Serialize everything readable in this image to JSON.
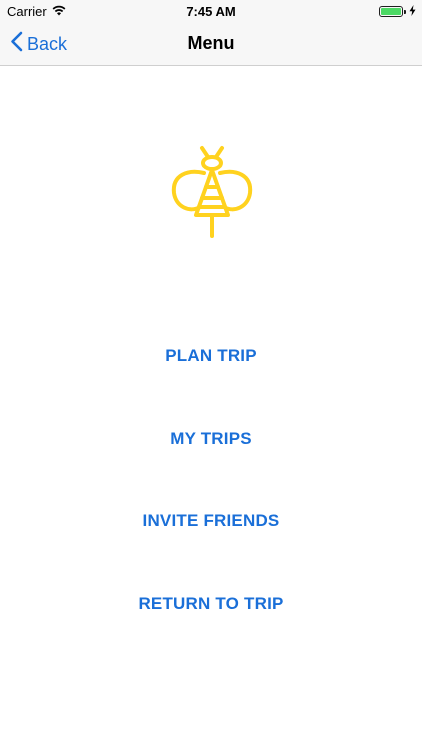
{
  "status_bar": {
    "carrier": "Carrier",
    "time": "7:45 AM",
    "battery_level": 1.0
  },
  "nav_bar": {
    "back_label": "Back",
    "title": "Menu"
  },
  "logo": {
    "icon": "bee-icon",
    "color": "#ffd21f"
  },
  "menu": {
    "items": [
      {
        "label": "PLAN TRIP"
      },
      {
        "label": "MY TRIPS"
      },
      {
        "label": "INVITE FRIENDS"
      },
      {
        "label": "RETURN TO TRIP"
      }
    ]
  },
  "colors": {
    "accent": "#1a6fd8",
    "battery": "#4cd964"
  }
}
